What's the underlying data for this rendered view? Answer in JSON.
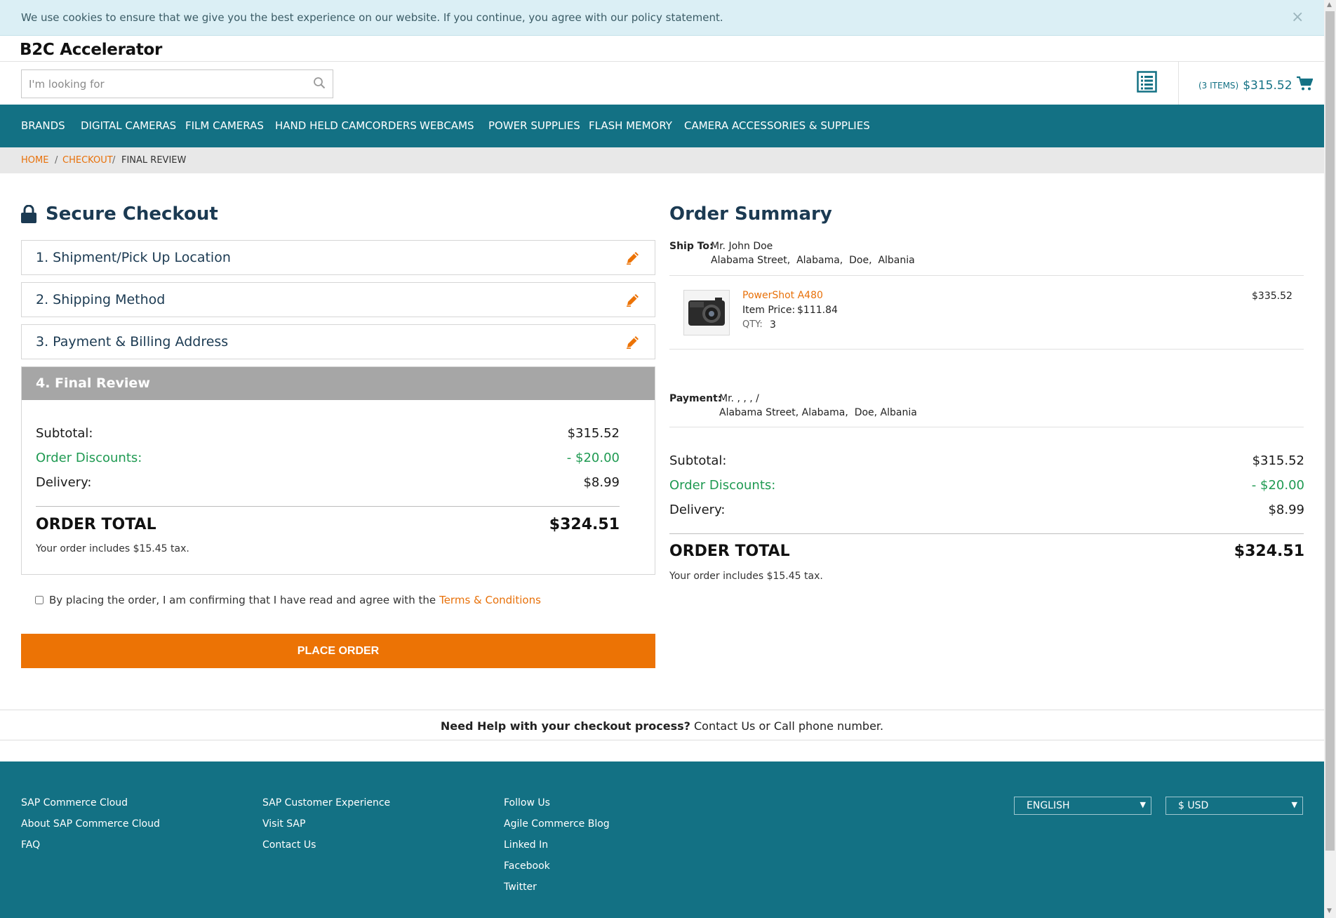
{
  "cookie": {
    "text": "We use cookies to ensure that we give you the best experience on our website. If you continue, you agree with our policy statement.",
    "close": "×"
  },
  "header": {
    "logo": "B2C Accelerator",
    "search_placeholder": "I'm looking for",
    "cart_items": "(3 ITEMS)",
    "cart_total": "$315.52"
  },
  "nav": {
    "items": [
      "BRANDS",
      "DIGITAL CAMERAS",
      "FILM CAMERAS",
      "HAND HELD CAMCORDERS",
      "WEBCAMS",
      "POWER SUPPLIES",
      "FLASH MEMORY",
      "CAMERA ACCESSORIES & SUPPLIES"
    ]
  },
  "breadcrumb": {
    "items": [
      "HOME",
      "CHECKOUT",
      "FINAL REVIEW"
    ],
    "separator": "/"
  },
  "checkout": {
    "title": "Secure Checkout",
    "steps": [
      "1. Shipment/Pick Up Location",
      "2. Shipping Method",
      "3. Payment & Billing Address"
    ],
    "active_step": "4. Final Review",
    "subtotal_label": "Subtotal:",
    "subtotal": "$315.52",
    "discounts_label": "Order Discounts:",
    "discounts": "- $20.00",
    "delivery_label": "Delivery:",
    "delivery": "$8.99",
    "total_label": "ORDER TOTAL",
    "total": "$324.51",
    "tax_note": "Your order includes $15.45 tax.",
    "terms_text": "By placing the order, I am confirming that I have read and agree with the",
    "terms_link": "Terms & Conditions",
    "place_order": "PLACE ORDER"
  },
  "summary": {
    "title": "Order Summary",
    "ship_to_label": "Ship To:",
    "ship_to_name": "Mr. John Doe",
    "ship_to_address": "Alabama Street,  Alabama,  Doe,  Albania",
    "product": {
      "name": "PowerShot A480",
      "price_label": "Item Price:",
      "price": "$111.84",
      "qty_label": "QTY:",
      "qty": "3",
      "line_total": "$335.52"
    },
    "payment_label": "Payment:",
    "payment_name": "Mr. , , , /",
    "payment_address": "Alabama Street, Alabama,  Doe, Albania",
    "subtotal_label": "Subtotal:",
    "subtotal": "$315.52",
    "discounts_label": "Order Discounts:",
    "discounts": "- $20.00",
    "delivery_label": "Delivery:",
    "delivery": "$8.99",
    "total_label": "ORDER TOTAL",
    "total": "$324.51",
    "tax_note": "Your order includes $15.45 tax."
  },
  "help": {
    "bold": "Need Help with your checkout process?",
    "rest": " Contact Us or Call phone number."
  },
  "footer": {
    "col1": [
      "SAP Commerce Cloud",
      "About SAP Commerce Cloud",
      "FAQ"
    ],
    "col2": [
      "SAP Customer Experience",
      "Visit SAP",
      "Contact Us"
    ],
    "col3": [
      "Follow Us",
      "Agile Commerce Blog",
      "Linked In",
      "Facebook",
      "Twitter"
    ],
    "language": "ENGLISH",
    "currency": "$ USD"
  },
  "colors": {
    "brand_teal": "#137184",
    "accent_orange": "#ec7305",
    "discount_green": "#1f9a52",
    "heading_navy": "#1b3a52"
  }
}
